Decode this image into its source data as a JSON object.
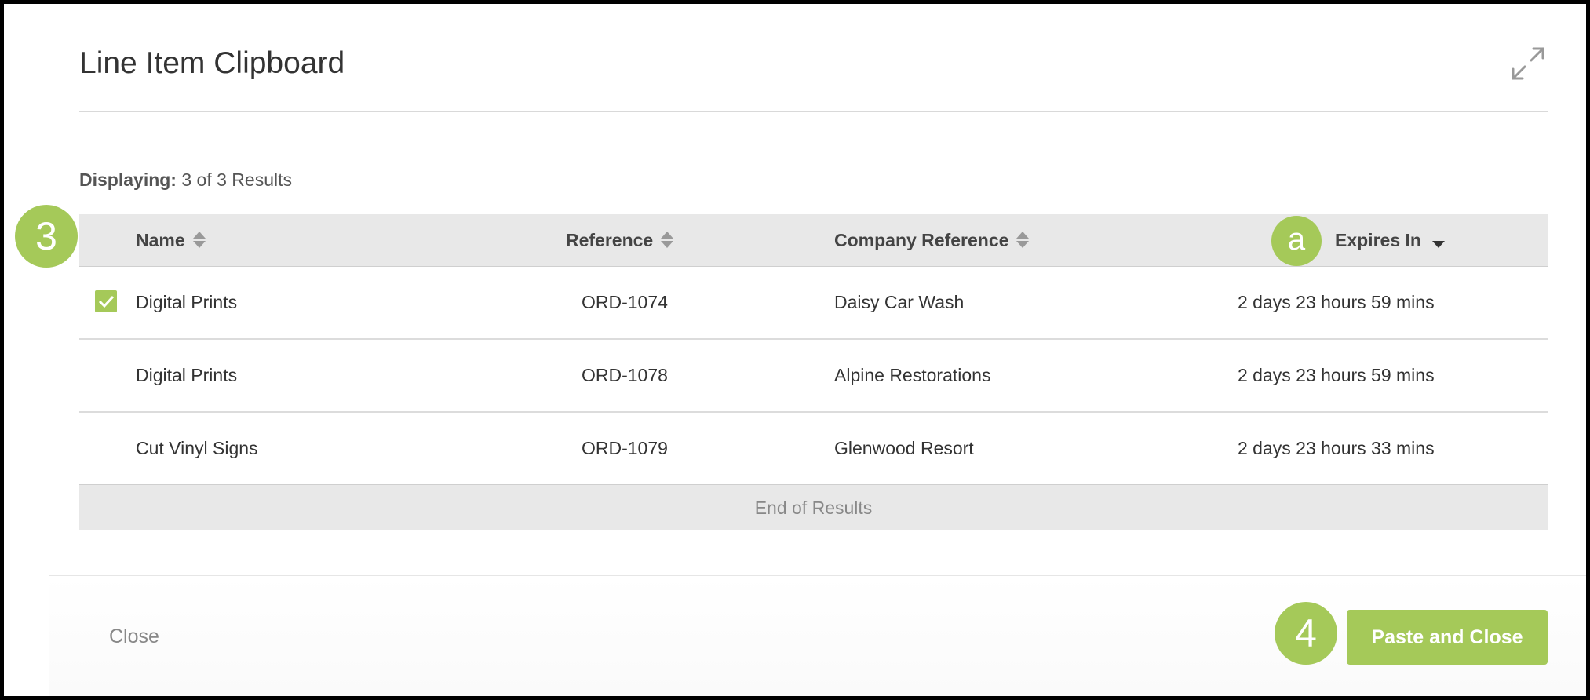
{
  "dialog": {
    "title": "Line Item Clipboard",
    "expand_icon": "expand-arrows-icon"
  },
  "results": {
    "label": "Displaying:",
    "count_text": "3 of 3 Results"
  },
  "table": {
    "headers": {
      "name": "Name",
      "reference": "Reference",
      "company_reference": "Company Reference",
      "expires_in": "Expires In"
    },
    "rows": [
      {
        "name": "Digital Prints",
        "reference": "ORD-1074",
        "company_reference": "Daisy Car Wash",
        "expires_in": "2 days 23 hours 59 mins",
        "selected": true
      },
      {
        "name": "Digital Prints",
        "reference": "ORD-1078",
        "company_reference": "Alpine Restorations",
        "expires_in": "2 days 23 hours 59 mins",
        "selected": false
      },
      {
        "name": "Cut Vinyl Signs",
        "reference": "ORD-1079",
        "company_reference": "Glenwood Resort",
        "expires_in": "2 days 23 hours 33 mins",
        "selected": false
      }
    ],
    "end_text": "End of Results"
  },
  "footer": {
    "close_label": "Close",
    "paste_label": "Paste and Close"
  },
  "callouts": {
    "step_3": "3",
    "step_a": "a",
    "step_4": "4"
  },
  "colors": {
    "accent": "#a5c959",
    "header_bg": "#e8e8e8"
  }
}
